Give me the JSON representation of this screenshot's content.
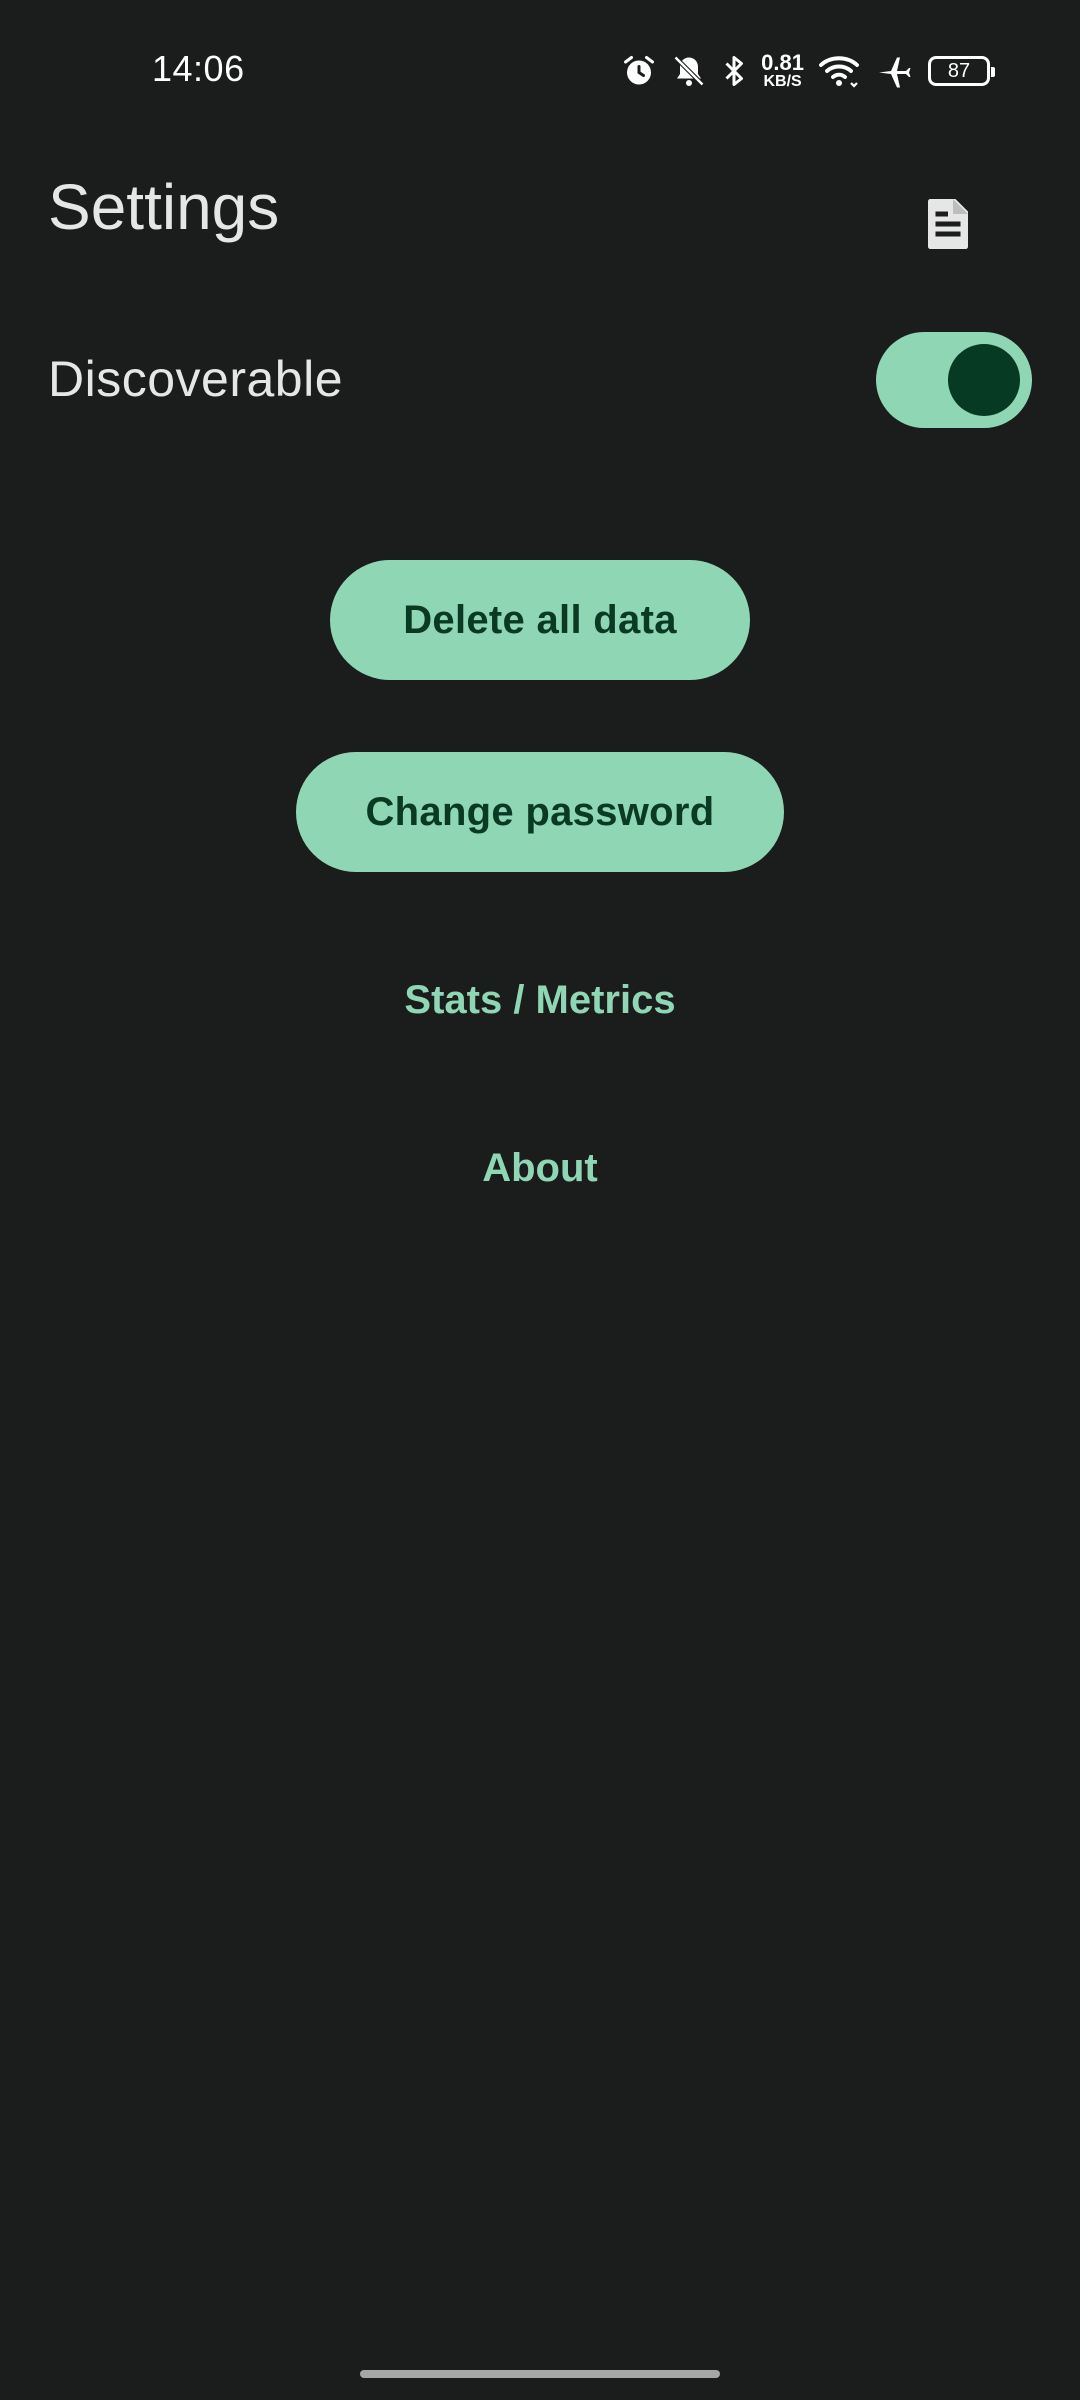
{
  "status_bar": {
    "time": "14:06",
    "net_speed_value": "0.81",
    "net_speed_unit": "KB/S",
    "battery_level": "87",
    "icons": [
      "alarm-icon",
      "bell-muted-icon",
      "bluetooth-icon",
      "wifi-icon",
      "airplane-icon",
      "battery-icon"
    ]
  },
  "header": {
    "title": "Settings",
    "action_icon": "document-icon"
  },
  "settings": {
    "discoverable_label": "Discoverable",
    "discoverable_on": true
  },
  "actions": {
    "delete_all_data": "Delete all data",
    "change_password": "Change password",
    "stats_metrics": "Stats / Metrics",
    "about": "About"
  },
  "colors": {
    "background": "#1b1c1c",
    "accent": "#8fd6b4",
    "accent_on": "#0a3a24",
    "text": "#e6e6e6"
  }
}
